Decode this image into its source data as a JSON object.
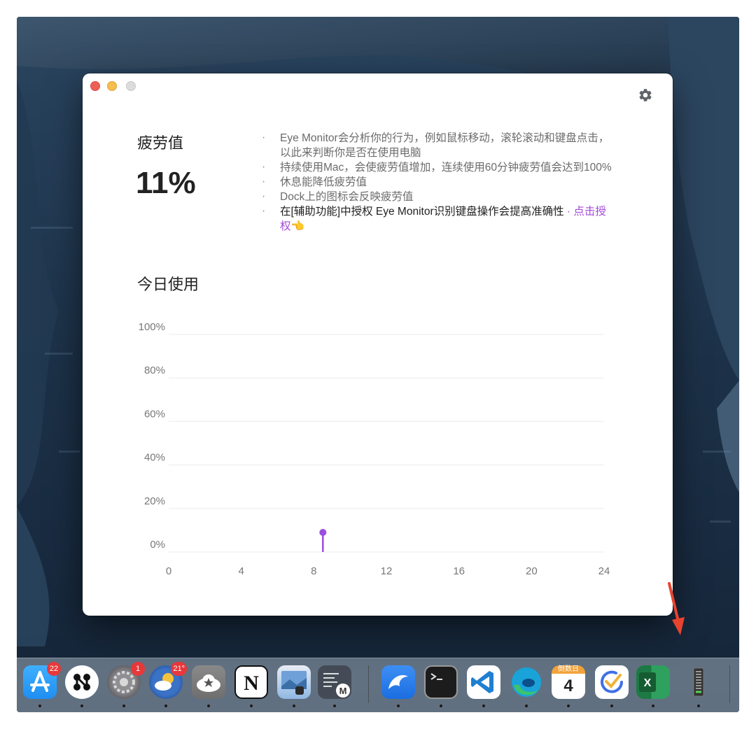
{
  "window": {
    "fatigue_title": "疲劳值",
    "fatigue_value": "11%",
    "bullets": [
      "Eye Monitor会分析你的行为，例如鼠标移动，滚轮滚动和键盘点击，以此来判断你是否在使用电脑",
      "持续使用Mac，会使疲劳值增加，连续使用60分钟疲劳值会达到100%",
      "休息能降低疲劳值",
      "Dock上的图标会反映疲劳值"
    ],
    "permission_text": "在[辅助功能]中授权 Eye Monitor识别键盘操作会提高准确性",
    "permission_sep": " · ",
    "permission_link": "点击授权",
    "permission_emoji": "👈",
    "today_title": "今日使用"
  },
  "chart_data": {
    "type": "line",
    "title": "今日使用",
    "x_ticks": [
      "0",
      "4",
      "8",
      "12",
      "16",
      "20",
      "24"
    ],
    "y_ticks": [
      "0%",
      "20%",
      "40%",
      "60%",
      "80%",
      "100%"
    ],
    "xlim": [
      0,
      24
    ],
    "ylim": [
      0,
      100
    ],
    "grid": true,
    "series": [
      {
        "points": [
          {
            "x": 8.5,
            "y": 0
          },
          {
            "x": 8.5,
            "y": 9
          }
        ]
      }
    ],
    "color": "#9b4de0"
  },
  "dock": {
    "apps": [
      {
        "name": "App Store",
        "icon": "app-store-icon",
        "badge": "22",
        "colors": [
          "#1f8ef1",
          "#ffffff"
        ]
      },
      {
        "name": "Craft",
        "icon": "craft-icon",
        "badge": "",
        "colors": [
          "#ffffff",
          "#111111"
        ]
      },
      {
        "name": "System Preferences",
        "icon": "system-preferences-icon",
        "badge": "1",
        "colors": [
          "#8e8e93",
          "#3a3a3c"
        ]
      },
      {
        "name": "Weather",
        "icon": "weather-icon",
        "badge": "21°",
        "colors": [
          "#3a72c5",
          "#f5c33b"
        ]
      },
      {
        "name": "Reeder",
        "icon": "reeder-icon",
        "badge": "",
        "colors": [
          "#6e6e6e",
          "#ffffff"
        ]
      },
      {
        "name": "Notion",
        "icon": "notion-icon",
        "badge": "",
        "colors": [
          "#ffffff",
          "#111111"
        ]
      },
      {
        "name": "Preview",
        "icon": "preview-icon",
        "badge": "",
        "colors": [
          "#8fb7e3",
          "#e9eef5"
        ]
      },
      {
        "name": "Script Editor",
        "icon": "script-editor-icon",
        "badge": "",
        "colors": [
          "#444b57",
          "#dddddd"
        ]
      },
      {
        "name": "Surf",
        "icon": "surf-icon",
        "badge": "",
        "colors": [
          "#1b6ee0",
          "#ffffff"
        ]
      },
      {
        "name": "Terminal",
        "icon": "terminal-icon",
        "badge": "",
        "colors": [
          "#1c1c1c",
          "#e0e0e0"
        ]
      },
      {
        "name": "VS Code",
        "icon": "vscode-icon",
        "badge": "",
        "colors": [
          "#ffffff",
          "#1f7fd1"
        ]
      },
      {
        "name": "Edge",
        "icon": "edge-icon",
        "badge": "",
        "colors": [
          "#1aa3d9",
          "#3bc46e"
        ]
      },
      {
        "name": "Countdown",
        "icon": "calendar-icon",
        "badge": "",
        "label_top": "倒数日",
        "label_num": "4",
        "colors": [
          "#f2a23a",
          "#ffffff"
        ]
      },
      {
        "name": "TickTick",
        "icon": "ticktick-icon",
        "badge": "",
        "colors": [
          "#ffffff",
          "#3f6fe8"
        ]
      },
      {
        "name": "Excel",
        "icon": "excel-icon",
        "badge": "",
        "colors": [
          "#1d7a45",
          "#ffffff"
        ]
      },
      {
        "name": "Eye Monitor",
        "icon": "eye-monitor-level-icon",
        "badge": "",
        "colors": [
          "#333333",
          "#5ad15a"
        ]
      }
    ]
  }
}
